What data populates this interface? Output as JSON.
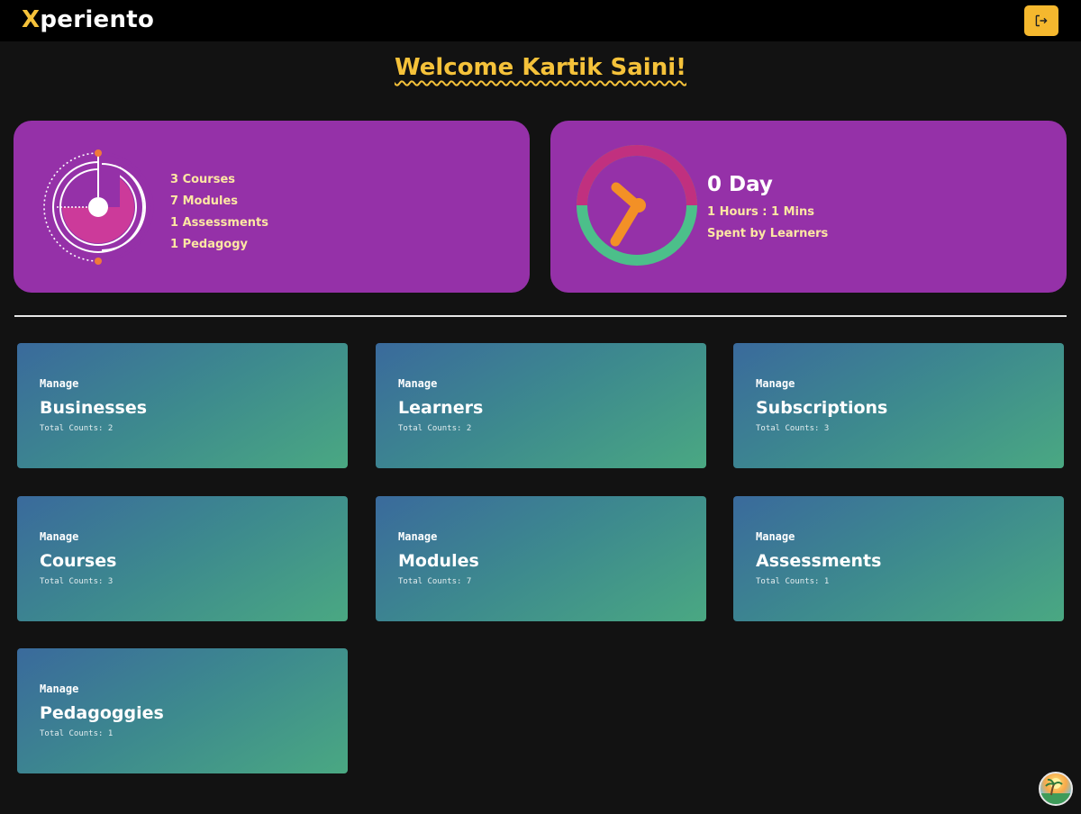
{
  "header": {
    "logo_first": "X",
    "logo_rest": "periento",
    "logout_icon": "logout-icon"
  },
  "welcome": "Welcome Kartik Saini!",
  "stats_left": {
    "items": [
      "3 Courses",
      "7 Modules",
      "1 Assessments",
      "1 Pedagogy"
    ]
  },
  "stats_right": {
    "day": "0 Day",
    "time": "1 Hours : 1 Mins",
    "spent": "Spent by Learners"
  },
  "tiles": [
    {
      "manage": "Manage",
      "title": "Businesses",
      "count": "Total Counts: 2"
    },
    {
      "manage": "Manage",
      "title": "Learners",
      "count": "Total Counts: 2"
    },
    {
      "manage": "Manage",
      "title": "Subscriptions",
      "count": "Total Counts: 3"
    },
    {
      "manage": "Manage",
      "title": "Courses",
      "count": "Total Counts: 3"
    },
    {
      "manage": "Manage",
      "title": "Modules",
      "count": "Total Counts: 7"
    },
    {
      "manage": "Manage",
      "title": "Assessments",
      "count": "Total Counts: 1"
    },
    {
      "manage": "Manage",
      "title": "Pedagoggies",
      "count": "Total Counts: 1"
    }
  ],
  "colors": {
    "accent": "#f5c23a",
    "card": "#9531a8",
    "tile_start": "#3a6a9c",
    "tile_end": "#4aa882"
  }
}
